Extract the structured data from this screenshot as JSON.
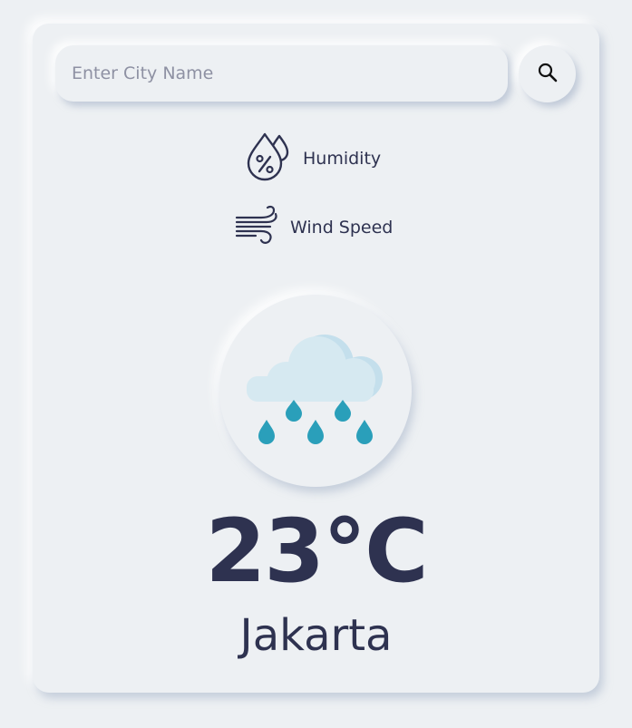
{
  "search": {
    "placeholder": "Enter City Name",
    "value": "",
    "button_icon": "search-icon"
  },
  "stats": {
    "humidity": {
      "label": "Humidity",
      "icon": "humidity-icon"
    },
    "wind": {
      "label": "Wind Speed",
      "icon": "wind-icon"
    }
  },
  "weather": {
    "icon": "rain-cloud-icon",
    "temperature": "23°C",
    "city": "Jakarta"
  },
  "colors": {
    "background": "#edf0f3",
    "text": "#2e3250",
    "placeholder": "#8e91a3",
    "cloud": "#d6e9f1",
    "rain_drop": "#2a9fba"
  }
}
